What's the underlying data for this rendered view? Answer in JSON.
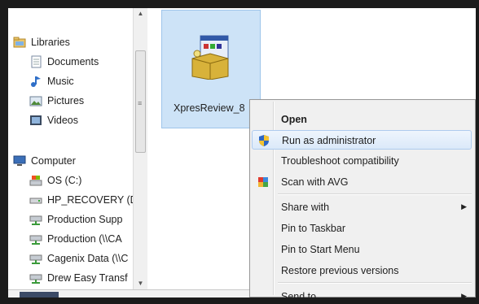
{
  "nav": {
    "items": [
      {
        "label": "Libraries",
        "icon": "libraries-icon"
      },
      {
        "label": "Documents",
        "icon": "documents-icon"
      },
      {
        "label": "Music",
        "icon": "music-icon"
      },
      {
        "label": "Pictures",
        "icon": "pictures-icon"
      },
      {
        "label": "Videos",
        "icon": "videos-icon"
      },
      {
        "label": "Computer",
        "icon": "computer-icon"
      },
      {
        "label": "OS (C:)",
        "icon": "drive-icon"
      },
      {
        "label": "HP_RECOVERY (D",
        "icon": "drive-icon"
      },
      {
        "label": "Production Supp",
        "icon": "network-drive-icon"
      },
      {
        "label": "Production (\\\\CA",
        "icon": "network-drive-icon"
      },
      {
        "label": "Cagenix Data (\\\\C",
        "icon": "network-drive-icon"
      },
      {
        "label": "Drew Easy Transf",
        "icon": "network-drive-icon"
      }
    ]
  },
  "file": {
    "label": "XpresReview_8",
    "icon": "installer-icon"
  },
  "context_menu": {
    "items": [
      {
        "label": "Open",
        "bold": true
      },
      {
        "label": "Run as administrator",
        "icon": "uac-shield-icon",
        "highlighted": true
      },
      {
        "label": "Troubleshoot compatibility"
      },
      {
        "label": "Scan with AVG",
        "icon": "avg-icon"
      },
      {
        "label": "Share with",
        "submenu": true
      },
      {
        "label": "Pin to Taskbar"
      },
      {
        "label": "Pin to Start Menu"
      },
      {
        "label": "Restore previous versions"
      },
      {
        "label": "Send to",
        "submenu": true
      }
    ]
  },
  "colors": {
    "selection": "#cde3f7",
    "menu_bg": "#f0f0f0",
    "highlight_border": "#aecbee"
  }
}
